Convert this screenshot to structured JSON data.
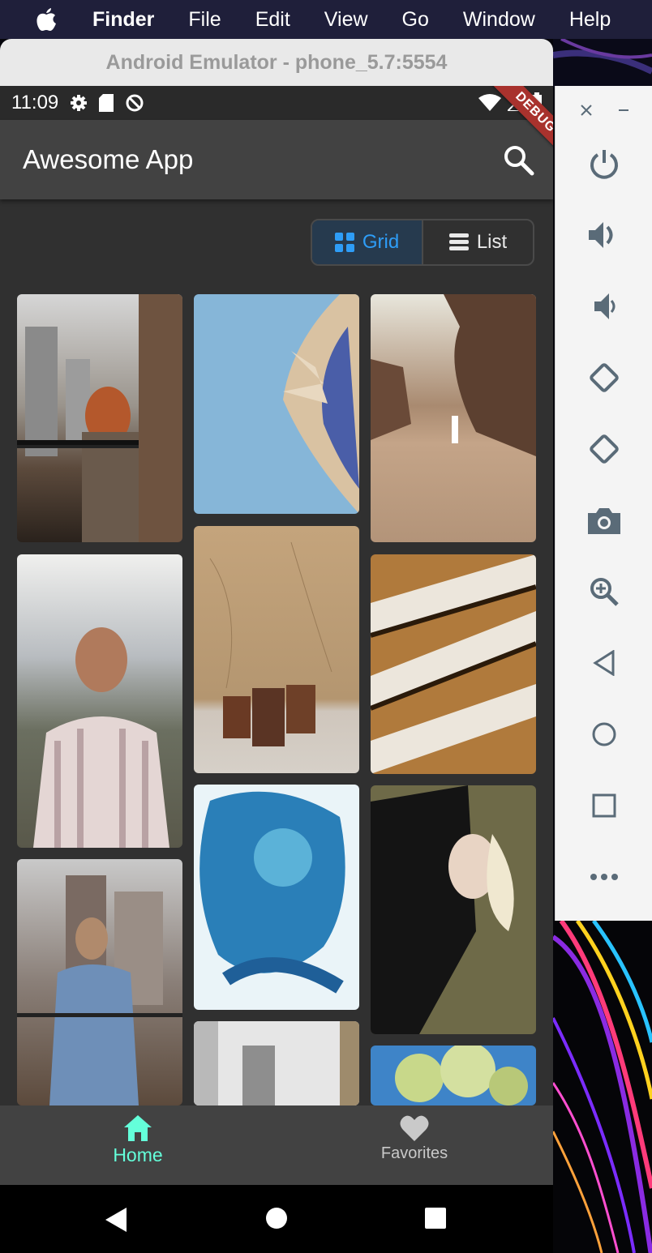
{
  "menubar": {
    "items": [
      "Finder",
      "File",
      "Edit",
      "View",
      "Go",
      "Window",
      "Help"
    ]
  },
  "emulator": {
    "window_title": "Android Emulator - phone_5.7:5554"
  },
  "statusbar": {
    "time": "11:09"
  },
  "appbar": {
    "title": "Awesome App",
    "debug_banner": "DEBUG"
  },
  "view_toggle": {
    "grid_label": "Grid",
    "list_label": "List",
    "selected": "Grid"
  },
  "bottom_nav": {
    "items": [
      {
        "label": "Home",
        "icon": "home-icon",
        "active": true
      },
      {
        "label": "Favorites",
        "icon": "heart-icon",
        "active": false
      }
    ]
  },
  "colors": {
    "active_nav": "#64ffda",
    "toggle_active": "#2e9df7",
    "debug_banner": "#a8322d"
  },
  "photos": [
    {
      "name": "woman-on-balcony"
    },
    {
      "name": "sculpture-sky"
    },
    {
      "name": "person-on-beach"
    },
    {
      "name": "man-striped-shirt"
    },
    {
      "name": "drums-wall"
    },
    {
      "name": "escalators"
    },
    {
      "name": "man-denim-jacket"
    },
    {
      "name": "blue-flower-paint"
    },
    {
      "name": "woman-sequin-dress"
    },
    {
      "name": "city-buildings"
    },
    {
      "name": "tree-blossoms"
    }
  ]
}
